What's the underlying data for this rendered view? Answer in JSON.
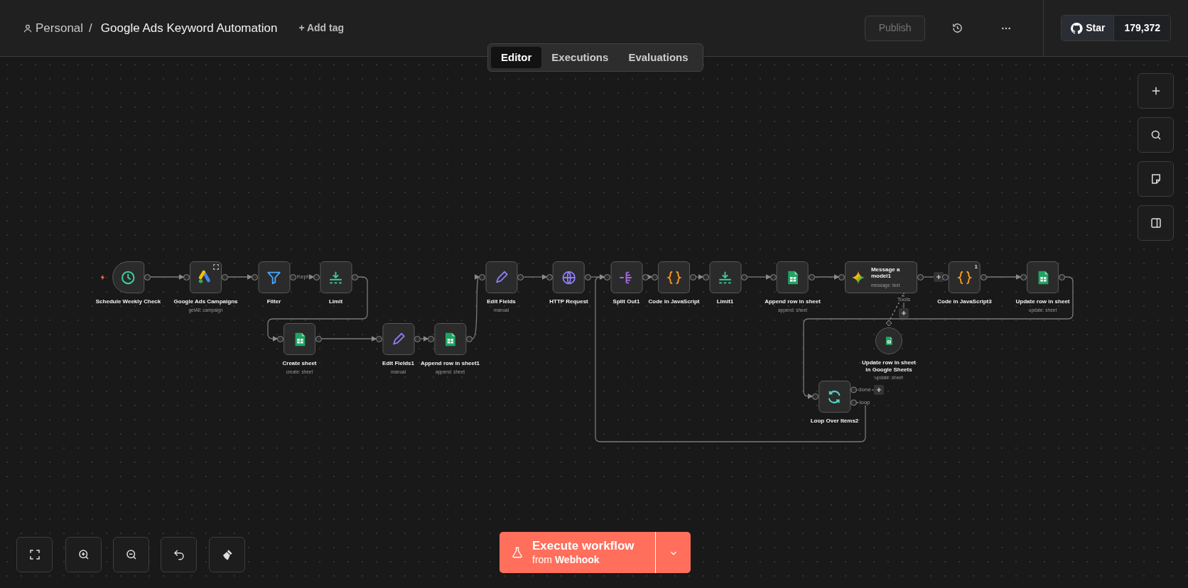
{
  "header": {
    "breadcrumb": "Personal",
    "separator": "/",
    "title": "Google Ads Keyword Automation",
    "add_tag": "+ Add tag",
    "publish": {
      "label": "Publish",
      "disabled": true
    },
    "github": {
      "label": "Star",
      "count": "179,372"
    }
  },
  "tabs": [
    {
      "label": "Editor",
      "selected": true
    },
    {
      "label": "Executions",
      "selected": false
    },
    {
      "label": "Evaluations",
      "selected": false
    }
  ],
  "nodes": [
    {
      "name": "Schedule Weekly Check",
      "kind": "schedule",
      "corner_icon": false
    },
    {
      "name": "Google Ads Campaigns",
      "subtitle": "getAll: campaign",
      "kind": "google-ads",
      "corner_icon": true
    },
    {
      "name": "Filter",
      "kind": "filter",
      "corner_icon": false
    },
    {
      "name": "Limit",
      "kind": "limit",
      "corner_icon": false
    },
    {
      "name": "Create sheet",
      "subtitle": "create: sheet",
      "kind": "sheets",
      "corner_icon": false
    },
    {
      "name": "Edit Fields1",
      "subtitle": "manual",
      "kind": "set",
      "corner_icon": false
    },
    {
      "name": "Append row in sheet1",
      "subtitle": "append: sheet",
      "kind": "sheets",
      "corner_icon": false
    },
    {
      "name": "Edit Fields",
      "subtitle": "manual",
      "kind": "set",
      "corner_icon": false
    },
    {
      "name": "HTTP Request",
      "kind": "http",
      "corner_icon": false
    },
    {
      "name": "Split Out1",
      "kind": "split",
      "corner_icon": false
    },
    {
      "name": "Code in JavaScript",
      "kind": "code",
      "corner_icon": false
    },
    {
      "name": "Limit1",
      "kind": "limit",
      "corner_icon": false
    },
    {
      "name": "Append row in sheet",
      "subtitle": "append: sheet",
      "kind": "sheets",
      "corner_icon": false
    },
    {
      "name": "Message a model1",
      "subtitle": "message: text",
      "kind": "llm",
      "corner_icon": false
    },
    {
      "name": "Code in JavaScript3",
      "kind": "code",
      "badge": "1",
      "corner_icon": false
    },
    {
      "name": "Update row in sheet",
      "subtitle": "update: sheet",
      "kind": "sheets",
      "corner_icon": false
    },
    {
      "name": "Update row in sheet in Google Sheets",
      "subtitle": "update: sheet",
      "kind": "sheets-tool",
      "corner_icon": false
    },
    {
      "name": "Loop Over Items2",
      "kind": "loop",
      "corner_icon": false
    }
  ],
  "connection_labels": [
    "Kept",
    "Tools",
    "done",
    "loop"
  ],
  "execute_button": {
    "label": "Execute workflow",
    "trigger": "from **Webhook**"
  }
}
